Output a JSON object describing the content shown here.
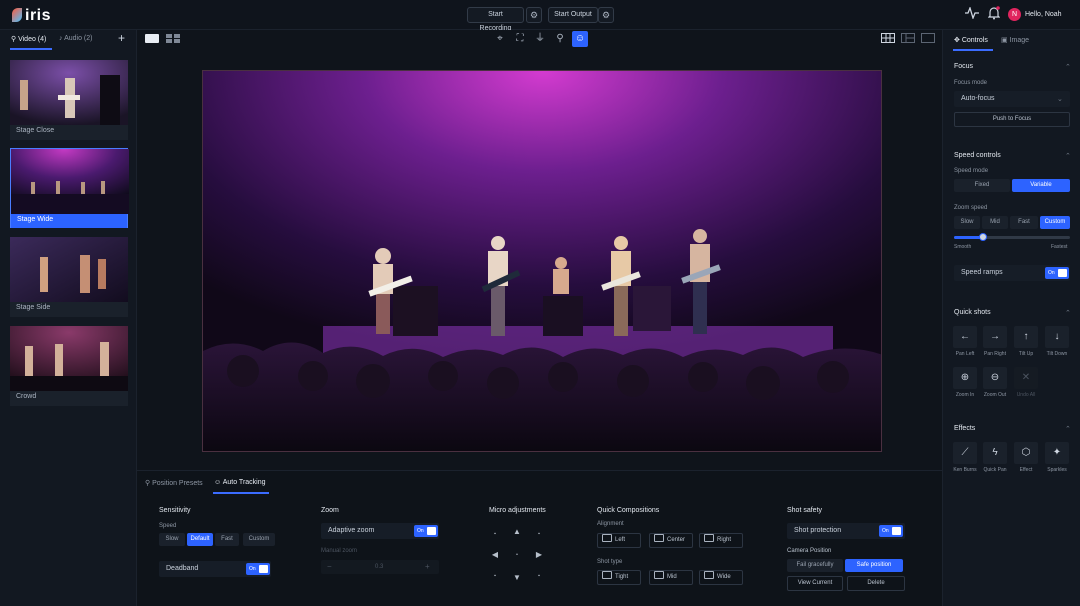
{
  "app": {
    "name": "iris"
  },
  "topbar": {
    "start_recording": "Start Recording",
    "start_output": "Start Output",
    "user_greeting": "Hello, Noah",
    "avatar_initial": "N"
  },
  "sources": {
    "tabs": [
      {
        "label": "Video (4)"
      },
      {
        "label": "Audio (2)"
      }
    ],
    "add": "+",
    "items": [
      {
        "label": "Stage Close"
      },
      {
        "label": "Stage Wide"
      },
      {
        "label": "Stage Side"
      },
      {
        "label": "Crowd"
      }
    ]
  },
  "bottom": {
    "tabs": [
      {
        "label": "Position Presets"
      },
      {
        "label": "Auto Tracking"
      }
    ],
    "sensitivity": {
      "title": "Sensitivity",
      "speed_label": "Speed",
      "speed_options": [
        "Slow",
        "Default",
        "Fast",
        "Custom"
      ],
      "deadband_label": "Deadband",
      "toggle_on": "On"
    },
    "zoom": {
      "title": "Zoom",
      "adaptive_label": "Adaptive zoom",
      "manual_label": "Manual zoom",
      "manual_value": "0.3",
      "minus": "−",
      "plus": "+"
    },
    "micro": {
      "title": "Micro adjustments"
    },
    "quick_comp": {
      "title": "Quick Compositions",
      "alignment_label": "Alignment",
      "alignment": [
        "Left",
        "Center",
        "Right"
      ],
      "shot_type_label": "Shot type",
      "shot_types": [
        "Tight",
        "Mid",
        "Wide"
      ]
    },
    "shot_safety": {
      "title": "Shot safety",
      "protection_label": "Shot protection",
      "camera_position_label": "Camera Position",
      "fail_gracefully": "Fail gracefully",
      "safe_position": "Safe position",
      "view_current": "View Current",
      "delete": "Delete"
    }
  },
  "right": {
    "tabs": [
      {
        "label": "Controls"
      },
      {
        "label": "Image"
      }
    ],
    "focus": {
      "title": "Focus",
      "mode_label": "Focus mode",
      "mode_value": "Auto-focus",
      "push_button": "Push to Focus"
    },
    "speed": {
      "title": "Speed controls",
      "mode_label": "Speed mode",
      "modes": [
        "Fixed",
        "Variable"
      ],
      "zoom_speed_label": "Zoom speed",
      "zoom_speeds": [
        "Slow",
        "Mid",
        "Fast",
        "Custom"
      ],
      "slider_min": "Smooth",
      "slider_max": "Fastest",
      "slider_value": 0.25,
      "ramps_label": "Speed ramps",
      "toggle_on": "On"
    },
    "quick_shots": {
      "title": "Quick shots",
      "items": [
        {
          "label": "Pan Left",
          "icon": "arrow-left-icon",
          "glyph": "←"
        },
        {
          "label": "Pan Right",
          "icon": "arrow-right-icon",
          "glyph": "→"
        },
        {
          "label": "Tilt Up",
          "icon": "arrow-up-icon",
          "glyph": "↑"
        },
        {
          "label": "Tilt Down",
          "icon": "arrow-down-icon",
          "glyph": "↓"
        },
        {
          "label": "Zoom In",
          "icon": "zoom-in-icon",
          "glyph": "⊕"
        },
        {
          "label": "Zoom Out",
          "icon": "zoom-out-icon",
          "glyph": "⊖"
        },
        {
          "label": "Undo All",
          "icon": "close-icon",
          "glyph": "✕"
        }
      ]
    },
    "effects": {
      "title": "Effects",
      "items": [
        {
          "label": "Ken Burns",
          "icon": "wand-icon",
          "glyph": "⟋"
        },
        {
          "label": "Quick Pan",
          "icon": "bolt-icon",
          "glyph": "ϟ"
        },
        {
          "label": "Effect",
          "icon": "cube-icon",
          "glyph": "⬡"
        },
        {
          "label": "Sparkles",
          "icon": "sparkles-icon",
          "glyph": "✦"
        }
      ]
    }
  },
  "colors": {
    "accent": "#2d63ff",
    "background": "#0d1118",
    "panel": "#121821"
  }
}
